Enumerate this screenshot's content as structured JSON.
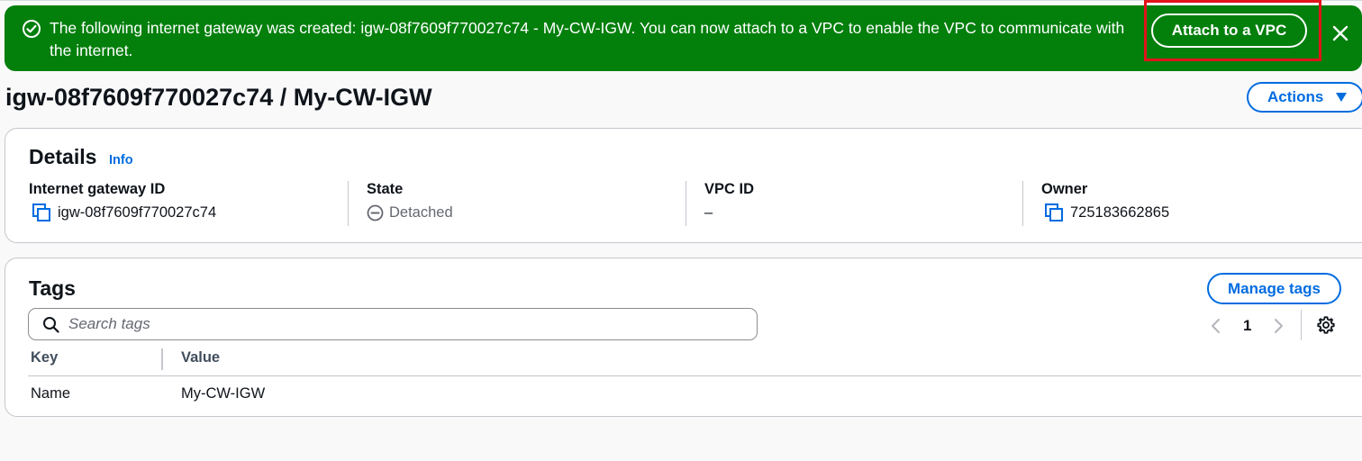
{
  "flash": {
    "message": "The following internet gateway was created: igw-08f7609f770027c74 - My-CW-IGW. You can now attach to a VPC to enable the VPC to communicate with the internet.",
    "action_label": "Attach to a VPC",
    "type": "success",
    "icon": "check-circle-icon",
    "close_icon": "close-icon",
    "color": "#037f0c"
  },
  "header": {
    "title": "igw-08f7609f770027c74 / My-CW-IGW",
    "actions_label": "Actions"
  },
  "details": {
    "title": "Details",
    "info_label": "Info",
    "fields": [
      {
        "label": "Internet gateway ID",
        "value": "igw-08f7609f770027c74",
        "icon": "copy-icon"
      },
      {
        "label": "State",
        "value": "Detached",
        "icon": "minus-circle-icon"
      },
      {
        "label": "VPC ID",
        "value": "–"
      },
      {
        "label": "Owner",
        "value": "725183662865",
        "icon": "copy-icon"
      }
    ]
  },
  "tags": {
    "title": "Tags",
    "manage_label": "Manage tags",
    "search_placeholder": "Search tags",
    "page": "1",
    "columns": [
      "Key",
      "Value"
    ],
    "rows": [
      {
        "key": "Name",
        "value": "My-CW-IGW"
      }
    ]
  },
  "colors": {
    "accent": "#006ce0",
    "success": "#037f0c",
    "highlight": "#e0141a"
  }
}
